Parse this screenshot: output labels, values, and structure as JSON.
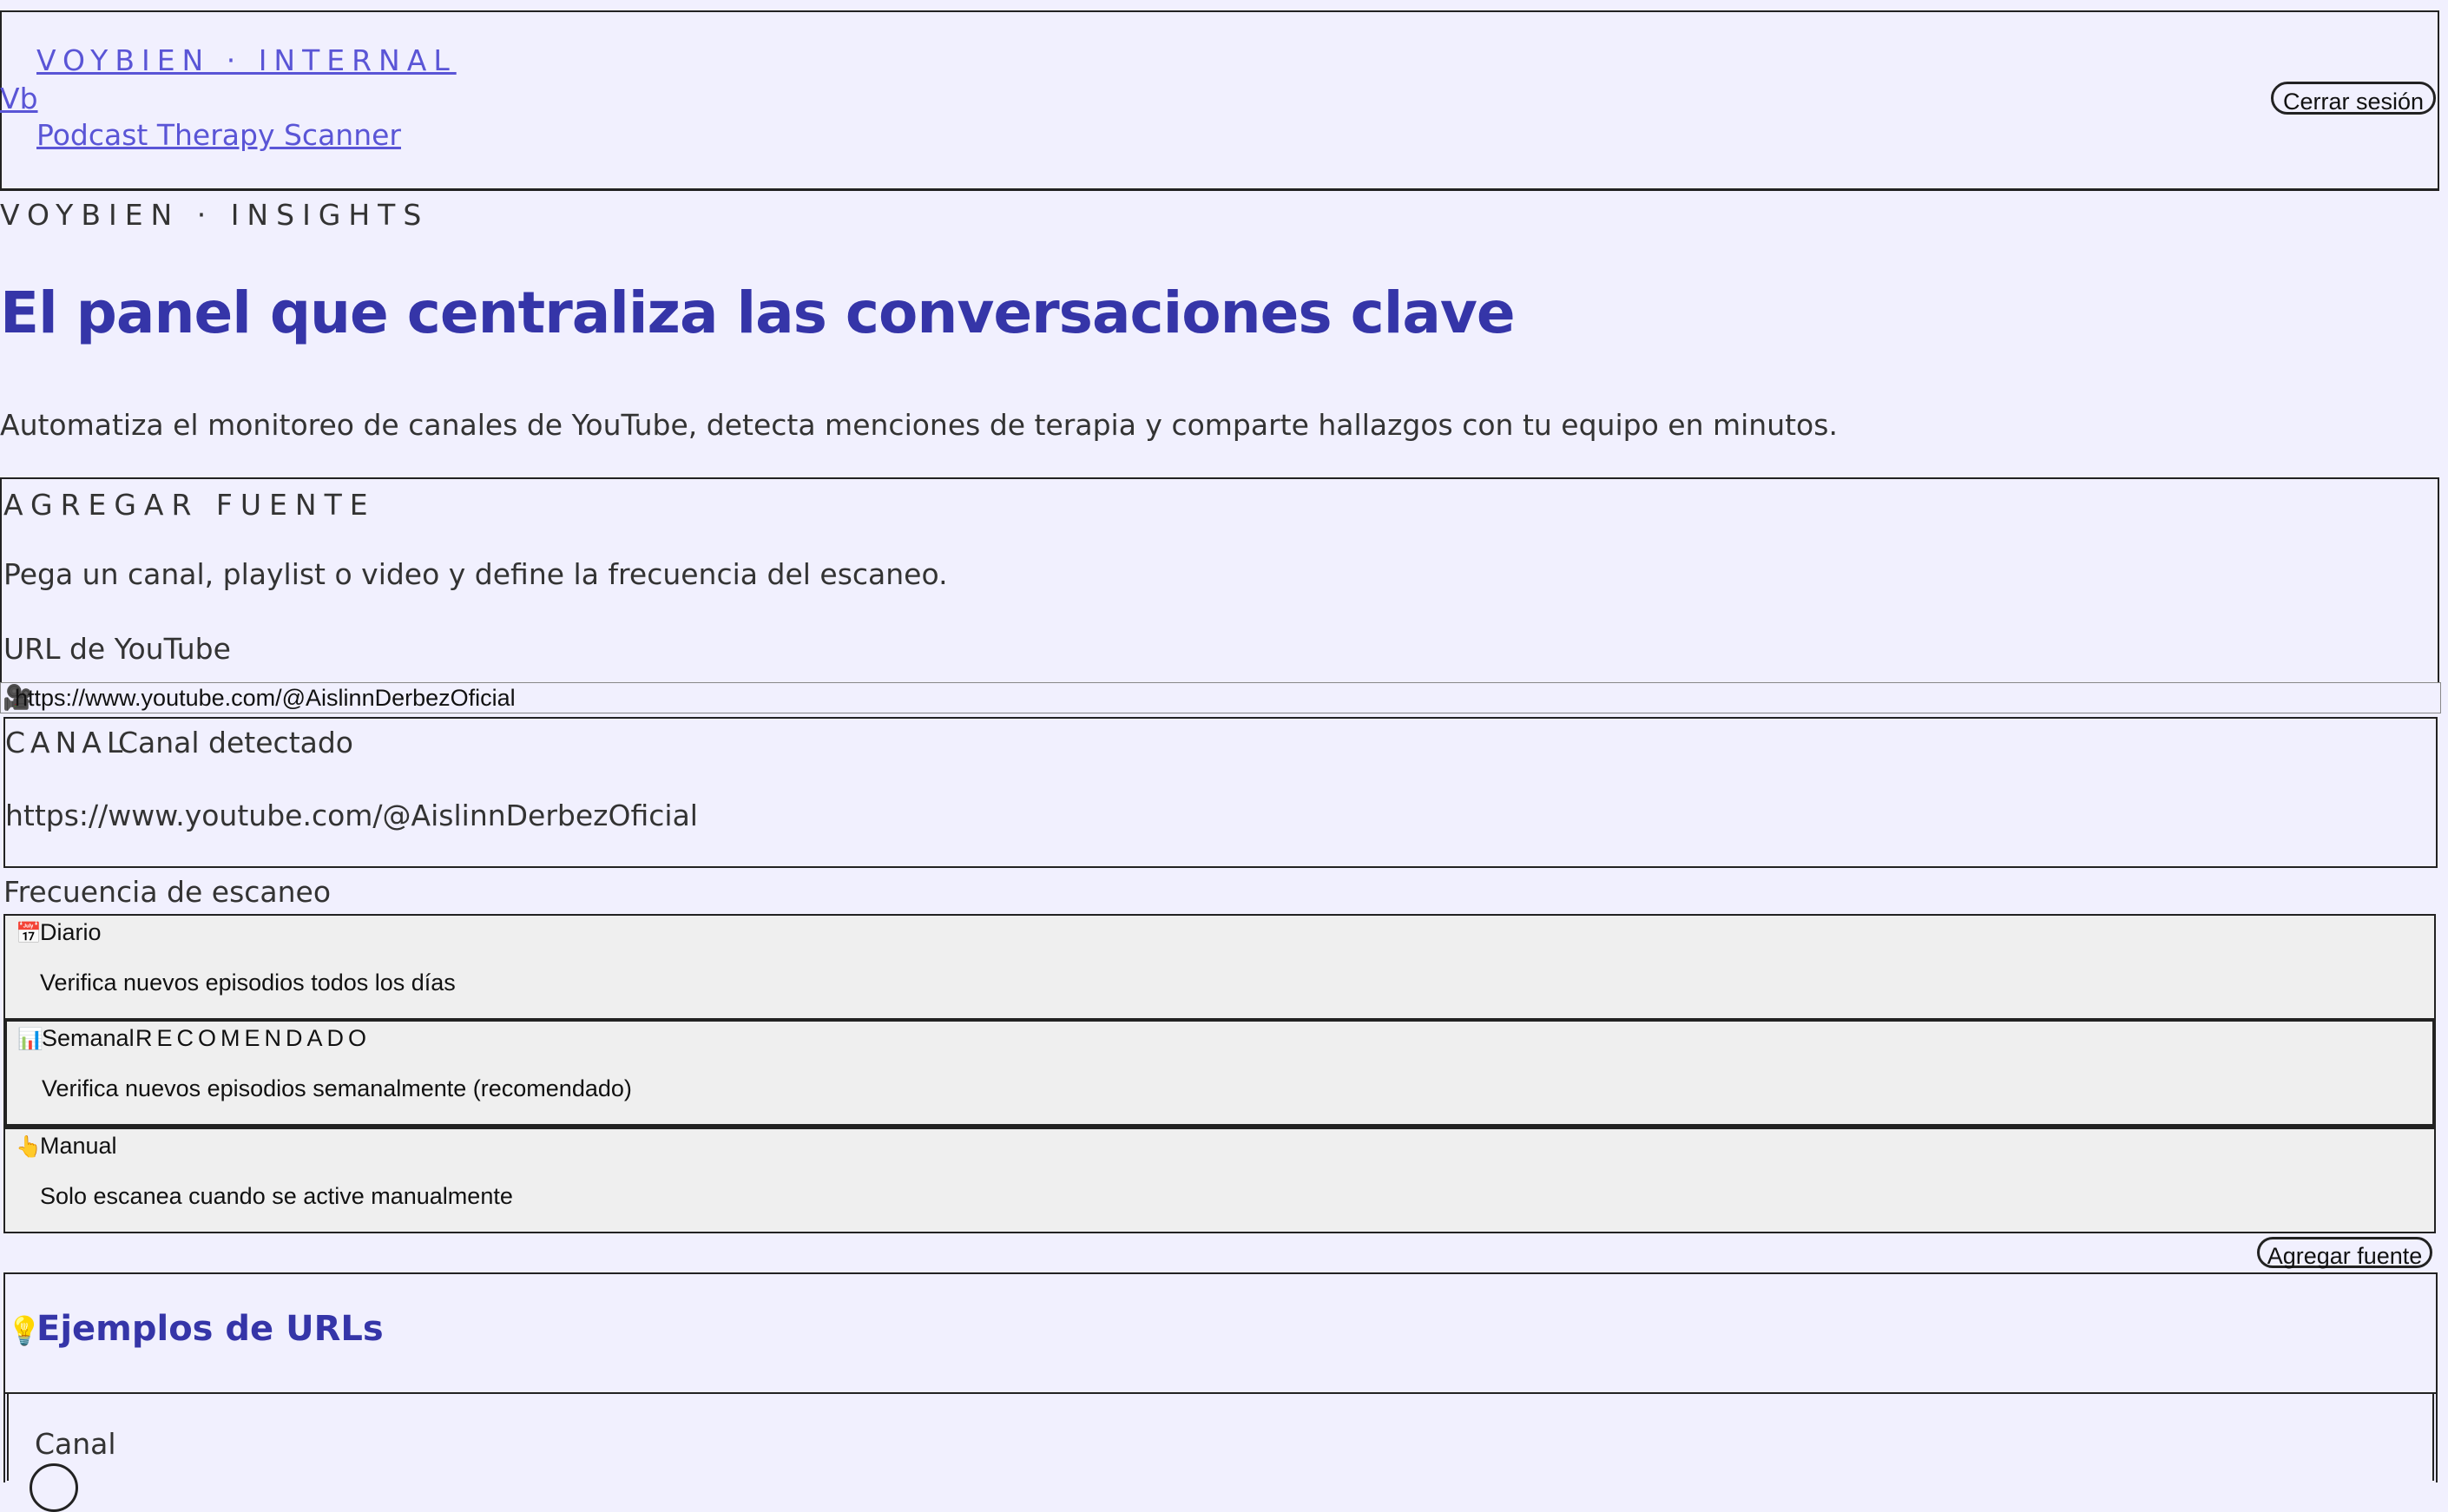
{
  "header": {
    "brand_small": "VOYBIEN · INTERNAL",
    "logo": "Vb",
    "brand_sub": "Podcast Therapy Scanner",
    "logout_label": "Cerrar sesión"
  },
  "hero": {
    "eyebrow": "VOYBIEN · INSIGHTS",
    "title": "El panel que centraliza las conversaciones clave",
    "description": "Automatiza el monitoreo de canales de YouTube, detecta menciones de terapia y comparte hallazgos con tu equipo en minutos."
  },
  "add_source": {
    "title": "AGREGAR FUENTE",
    "description": "Pega un canal, playlist o video y define la frecuencia del escaneo.",
    "url_label": "URL de YouTube",
    "url_icon": "camera-icon",
    "url_value": "https://www.youtube.com/@AislinnDerbezOficial",
    "detected": {
      "badge": "CANAL",
      "label": "Canal detectado",
      "url": "https://www.youtube.com/@AislinnDerbezOficial"
    },
    "frequency_label": "Frecuencia de escaneo",
    "options": [
      {
        "icon": "calendar-icon",
        "glyph": "📅",
        "name": "Diario",
        "badge": "",
        "description": "Verifica nuevos episodios todos los días",
        "selected": false
      },
      {
        "icon": "chart-icon",
        "glyph": "📊",
        "name": "Semanal",
        "badge": "RECOMENDADO",
        "description": "Verifica nuevos episodios semanalmente (recomendado)",
        "selected": true
      },
      {
        "icon": "hand-icon",
        "glyph": "👆",
        "name": "Manual",
        "badge": "",
        "description": "Solo escanea cuando se active manualmente",
        "selected": false
      }
    ],
    "submit_label": "Agregar fuente"
  },
  "examples": {
    "icon": "lightbulb-icon",
    "title": "Ejemplos de URLs",
    "items": [
      "Canal"
    ]
  }
}
